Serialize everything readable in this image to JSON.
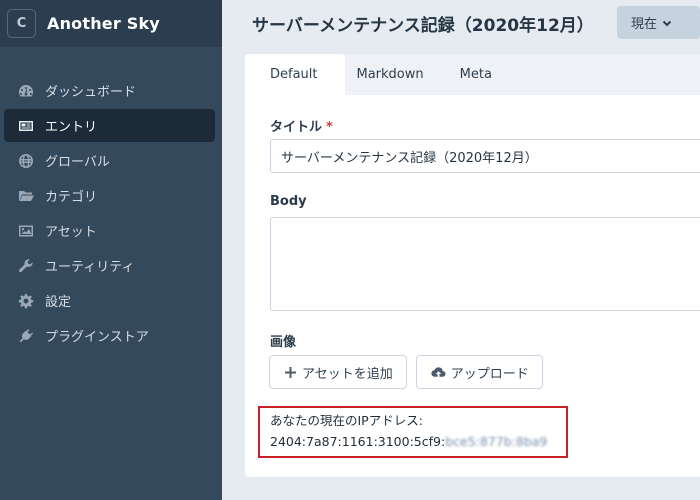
{
  "app": {
    "logo_letter": "C",
    "name": "Another Sky"
  },
  "sidebar": {
    "items": [
      {
        "label": "ダッシュボード",
        "icon": "dashboard-icon",
        "active": false
      },
      {
        "label": "エントリ",
        "icon": "newspaper-icon",
        "active": true
      },
      {
        "label": "グローバル",
        "icon": "globe-icon",
        "active": false
      },
      {
        "label": "カテゴリ",
        "icon": "folder-icon",
        "active": false
      },
      {
        "label": "アセット",
        "icon": "image-icon",
        "active": false
      },
      {
        "label": "ユーティリティ",
        "icon": "wrench-icon",
        "active": false
      },
      {
        "label": "設定",
        "icon": "gear-icon",
        "active": false
      },
      {
        "label": "プラグインストア",
        "icon": "plug-icon",
        "active": false
      }
    ]
  },
  "header": {
    "title": "サーバーメンテナンス記録（2020年12月）",
    "site_button": "現在"
  },
  "tabs": [
    {
      "label": "Default",
      "active": true
    },
    {
      "label": "Markdown",
      "active": false
    },
    {
      "label": "Meta",
      "active": false
    }
  ],
  "form": {
    "title_label": "タイトル",
    "required_mark": "*",
    "title_value": "サーバーメンテナンス記録（2020年12月）",
    "body_label": "Body",
    "body_value": "",
    "image_label": "画像",
    "add_asset": "アセットを追加",
    "upload": "アップロード"
  },
  "ip_notice": {
    "label": "あなたの現在のIPアドレス:",
    "ip_visible": "2404:7a87:1161:3100:5cf9:",
    "ip_masked": "bce5:877b:8ba9"
  },
  "colors": {
    "sidebar": "#34495c",
    "sidebar_active": "#1d2a37",
    "highlight_border": "#c62025",
    "required": "#d33a2c"
  }
}
